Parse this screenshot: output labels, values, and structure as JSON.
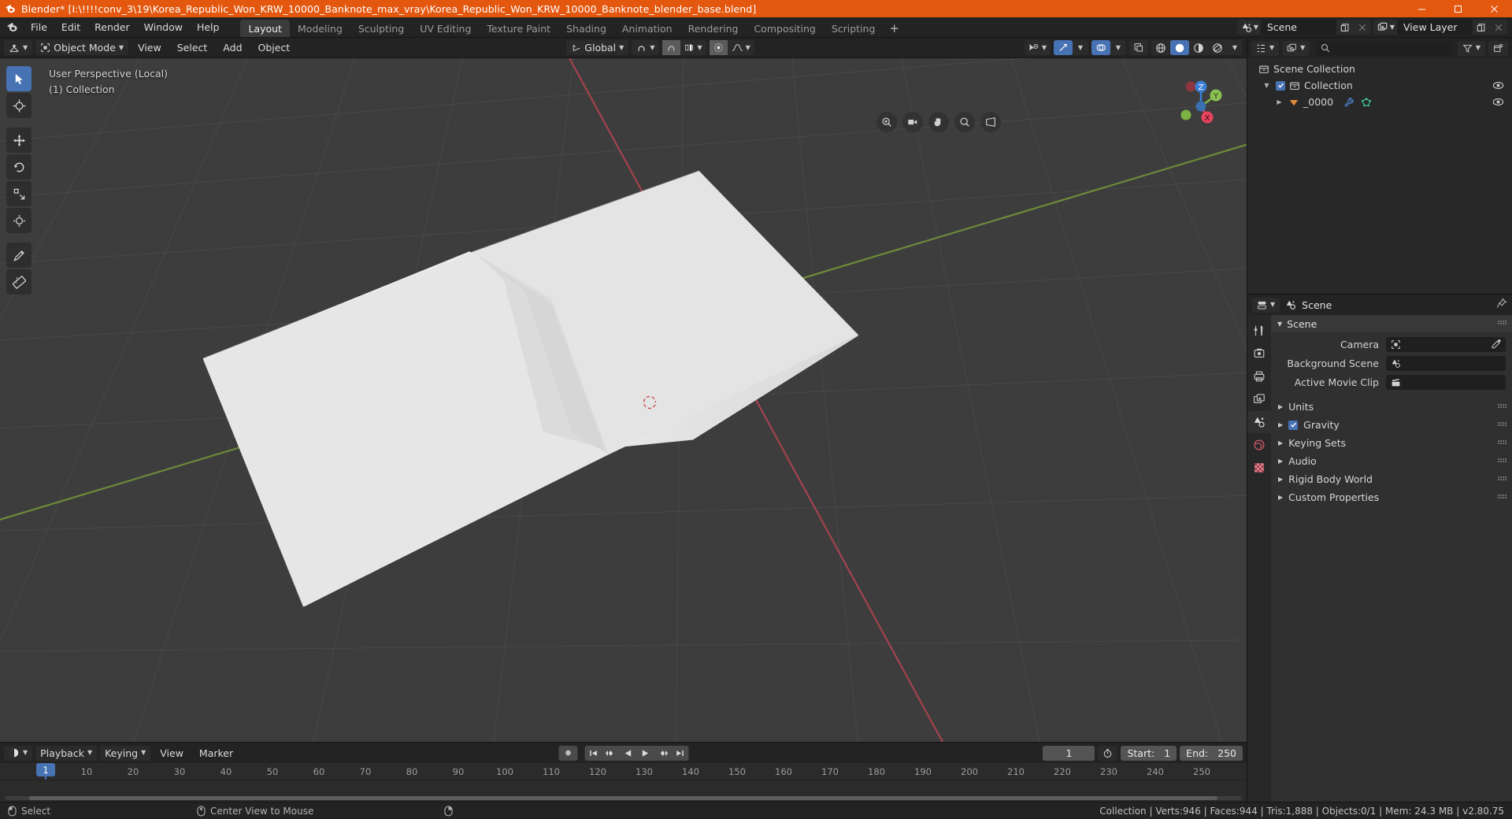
{
  "window": {
    "title": "Blender* [I:\\!!!!conv_3\\19\\Korea_Republic_Won_KRW_10000_Banknote_max_vray\\Korea_Republic_Won_KRW_10000_Banknote_blender_base.blend]",
    "accent_color": "#e3570f"
  },
  "topbar": {
    "menus": [
      "File",
      "Edit",
      "Render",
      "Window",
      "Help"
    ],
    "workspaces": [
      {
        "label": "Layout",
        "active": true
      },
      {
        "label": "Modeling",
        "active": false
      },
      {
        "label": "Sculpting",
        "active": false
      },
      {
        "label": "UV Editing",
        "active": false
      },
      {
        "label": "Texture Paint",
        "active": false
      },
      {
        "label": "Shading",
        "active": false
      },
      {
        "label": "Animation",
        "active": false
      },
      {
        "label": "Rendering",
        "active": false
      },
      {
        "label": "Compositing",
        "active": false
      },
      {
        "label": "Scripting",
        "active": false
      }
    ],
    "add_workspace_label": "+",
    "scene_name": "Scene",
    "view_layer_name": "View Layer"
  },
  "viewport": {
    "header": {
      "mode": "Object Mode",
      "menus": [
        "View",
        "Select",
        "Add",
        "Object"
      ],
      "transform_orientation": "Global"
    },
    "overlay_line1": "User Perspective (Local)",
    "overlay_line2": "(1) Collection",
    "gizmo_axes": [
      "X",
      "Y",
      "Z"
    ],
    "tools": [
      "select-box-tool",
      "cursor-tool",
      "move-tool",
      "rotate-tool",
      "scale-tool",
      "transform-tool",
      "annotate-tool",
      "measure-tool"
    ]
  },
  "timeline": {
    "editor_label": "Timeline",
    "menus": [
      "Playback",
      "Keying",
      "View",
      "Marker"
    ],
    "current_frame": "1",
    "start_label": "Start:",
    "start_value": "1",
    "end_label": "End:",
    "end_value": "250",
    "ticks": [
      "10",
      "20",
      "30",
      "40",
      "50",
      "60",
      "70",
      "80",
      "90",
      "100",
      "110",
      "120",
      "130",
      "140",
      "150",
      "160",
      "170",
      "180",
      "190",
      "200",
      "210",
      "220",
      "230",
      "240",
      "250"
    ],
    "playhead_label": "1"
  },
  "outliner": {
    "search_placeholder": "",
    "rows": [
      {
        "label": "Scene Collection",
        "indent": 0,
        "icon": "collection-icon",
        "has_disclosure": false,
        "has_checkbox": false,
        "has_eye": false
      },
      {
        "label": "Collection",
        "indent": 1,
        "icon": "collection-icon",
        "has_disclosure": true,
        "has_checkbox": true,
        "has_eye": true
      },
      {
        "label": "_0000",
        "indent": 2,
        "icon": "mesh-object-icon",
        "has_disclosure": true,
        "has_checkbox": false,
        "has_eye": true,
        "extra_icons": [
          "modifier-wrench-icon",
          "mesh-data-icon"
        ]
      }
    ]
  },
  "properties": {
    "breadcrumb": "Scene",
    "tabs": [
      "tool-icon",
      "render-icon",
      "output-icon",
      "view-layer-icon",
      "scene-icon",
      "world-icon",
      "texture-icon"
    ],
    "panel_title": "Scene",
    "fields": [
      {
        "label": "Camera",
        "value": "",
        "icon": "camera-icon",
        "right_icon": "eyedropper-icon"
      },
      {
        "label": "Background Scene",
        "value": "",
        "icon": "scene-icon",
        "right_icon": ""
      },
      {
        "label": "Active Movie Clip",
        "value": "",
        "icon": "movieclip-icon",
        "right_icon": ""
      }
    ],
    "collapsed_panels": [
      {
        "label": "Units",
        "checkbox": null
      },
      {
        "label": "Gravity",
        "checkbox": true
      },
      {
        "label": "Keying Sets",
        "checkbox": null
      },
      {
        "label": "Audio",
        "checkbox": null
      },
      {
        "label": "Rigid Body World",
        "checkbox": null
      },
      {
        "label": "Custom Properties",
        "checkbox": null
      }
    ]
  },
  "statusbar": {
    "left_items": [
      {
        "icon": "mouse-left-icon",
        "label": "Select"
      },
      {
        "icon": "mouse-middle-icon",
        "label": "Center View to Mouse"
      },
      {
        "icon": "mouse-right-icon",
        "label": ""
      }
    ],
    "stats": "Collection | Verts:946 | Faces:944 | Tris:1,888 | Objects:0/1 | Mem: 24.3 MB | v2.80.75"
  }
}
